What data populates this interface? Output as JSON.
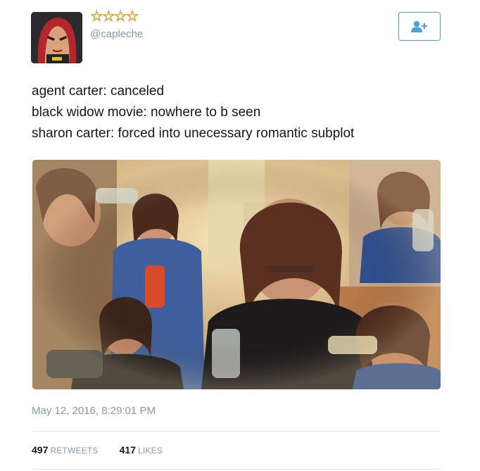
{
  "author": {
    "stars": "☆☆☆☆",
    "handle": "@capleche",
    "avatar_icon": "avatar-illustration"
  },
  "follow_button": {
    "icon": "add-user-icon",
    "color": "#4aa3df"
  },
  "tweet": {
    "lines": [
      "agent carter: canceled",
      "black widow movie: nowhere to b seen",
      "sharon carter: forced into unecessary romantic subplot"
    ]
  },
  "media": {
    "icon": "photo-collage"
  },
  "timestamp": "May 12, 2016, 8:29:01 PM",
  "stats": {
    "retweets_count": "497",
    "retweets_label": "RETWEETS",
    "likes_count": "417",
    "likes_label": "LIKES"
  }
}
